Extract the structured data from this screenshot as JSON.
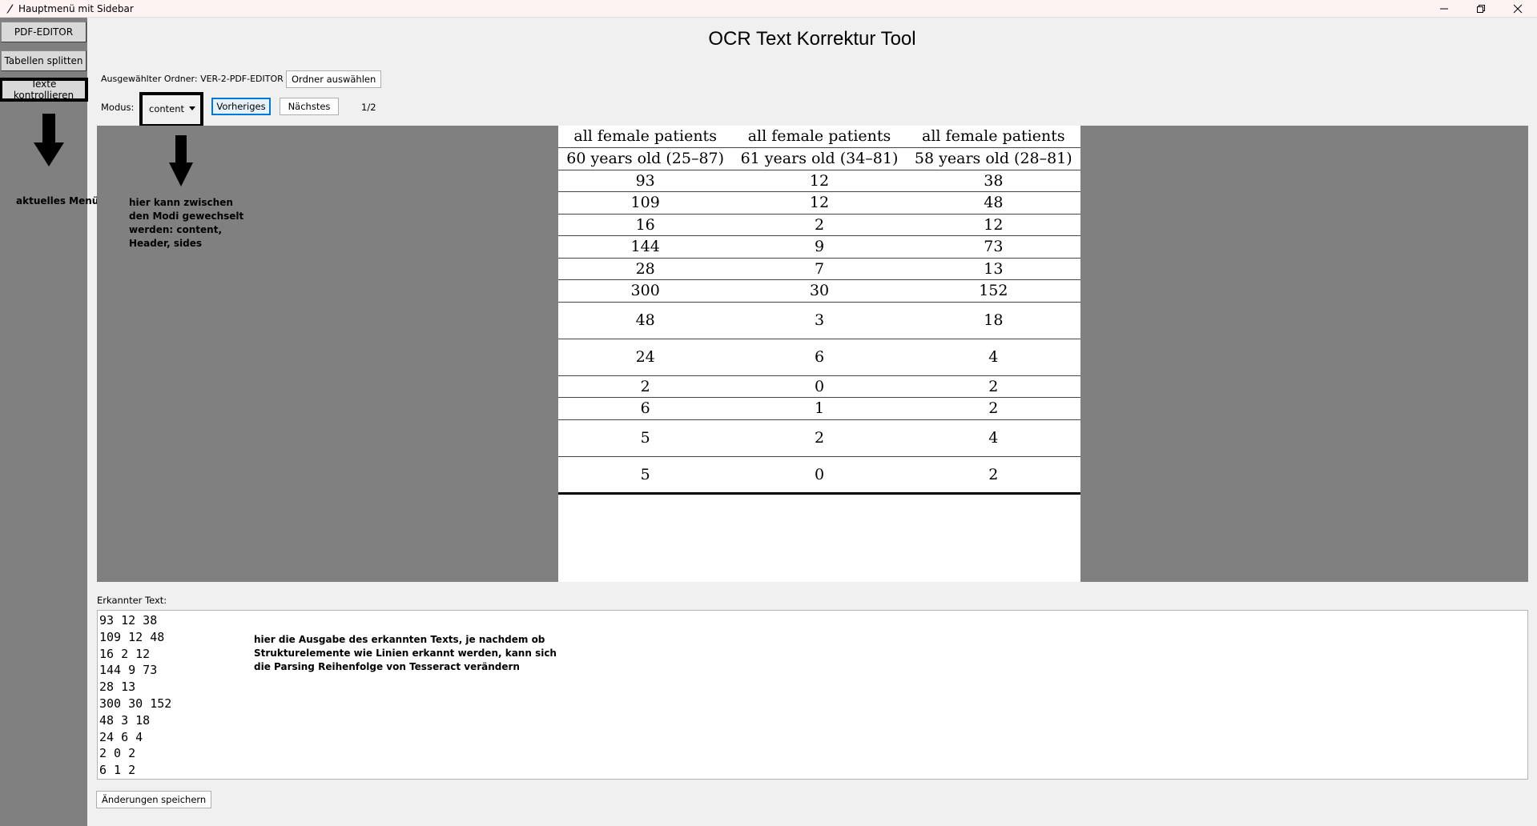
{
  "window": {
    "title": "Hauptmenü mit Sidebar",
    "app_icon": "feather-icon",
    "controls": [
      "minimize-icon",
      "restore-icon",
      "close-icon"
    ]
  },
  "sidebar": {
    "items": [
      {
        "label": "PDF-EDITOR"
      },
      {
        "label": "Tabellen splitten"
      },
      {
        "label": "Texte kontrollieren",
        "active": true
      }
    ],
    "annotation": "aktuelles Menü"
  },
  "main": {
    "title": "OCR Text Korrektur Tool",
    "folder_label": "Ausgewählter Ordner: VER-2-PDF-EDITOR",
    "choose_folder_button": "Ordner auswählen",
    "mode_label": "Modus:",
    "mode_value": "content",
    "prev_button": "Vorheriges",
    "next_button": "Nächstes",
    "page_indicator": "1/2",
    "mode_annotation": "hier kann zwischen den Modi gewechselt werden: content, Header, sides"
  },
  "scan_table": {
    "headers": [
      [
        "all female patients",
        "all female patients",
        "all female patients"
      ],
      [
        "60 years old (25–87)",
        "61 years old (34–81)",
        "58 years old (28–81)"
      ]
    ],
    "rows": [
      [
        "93",
        "12",
        "38"
      ],
      [
        "109",
        "12",
        "48"
      ],
      [
        "16",
        "2",
        "12"
      ],
      [
        "144",
        "9",
        "73"
      ],
      [
        "28",
        "7",
        "13"
      ],
      [
        "300",
        "30",
        "152"
      ],
      [
        "48",
        "3",
        "18"
      ],
      [
        "24",
        "6",
        "4"
      ],
      [
        "2",
        "0",
        "2"
      ],
      [
        "6",
        "1",
        "2"
      ],
      [
        "5",
        "2",
        "4"
      ],
      [
        "5",
        "0",
        "2"
      ]
    ]
  },
  "ocr": {
    "label": "Erkannter Text:",
    "text": "93 12 38\n109 12 48\n16 2 12\n144 9 73\n28 13\n300 30 152\n48 3 18\n24 6 4\n2 0 2\n6 1 2",
    "annotation": "hier die Ausgabe des erkannten Texts, je nachdem ob Strukturelemente wie Linien erkannt werden, kann sich die Parsing Reihenfolge von Tesseract verändern"
  },
  "save_button": "Änderungen speichern"
}
